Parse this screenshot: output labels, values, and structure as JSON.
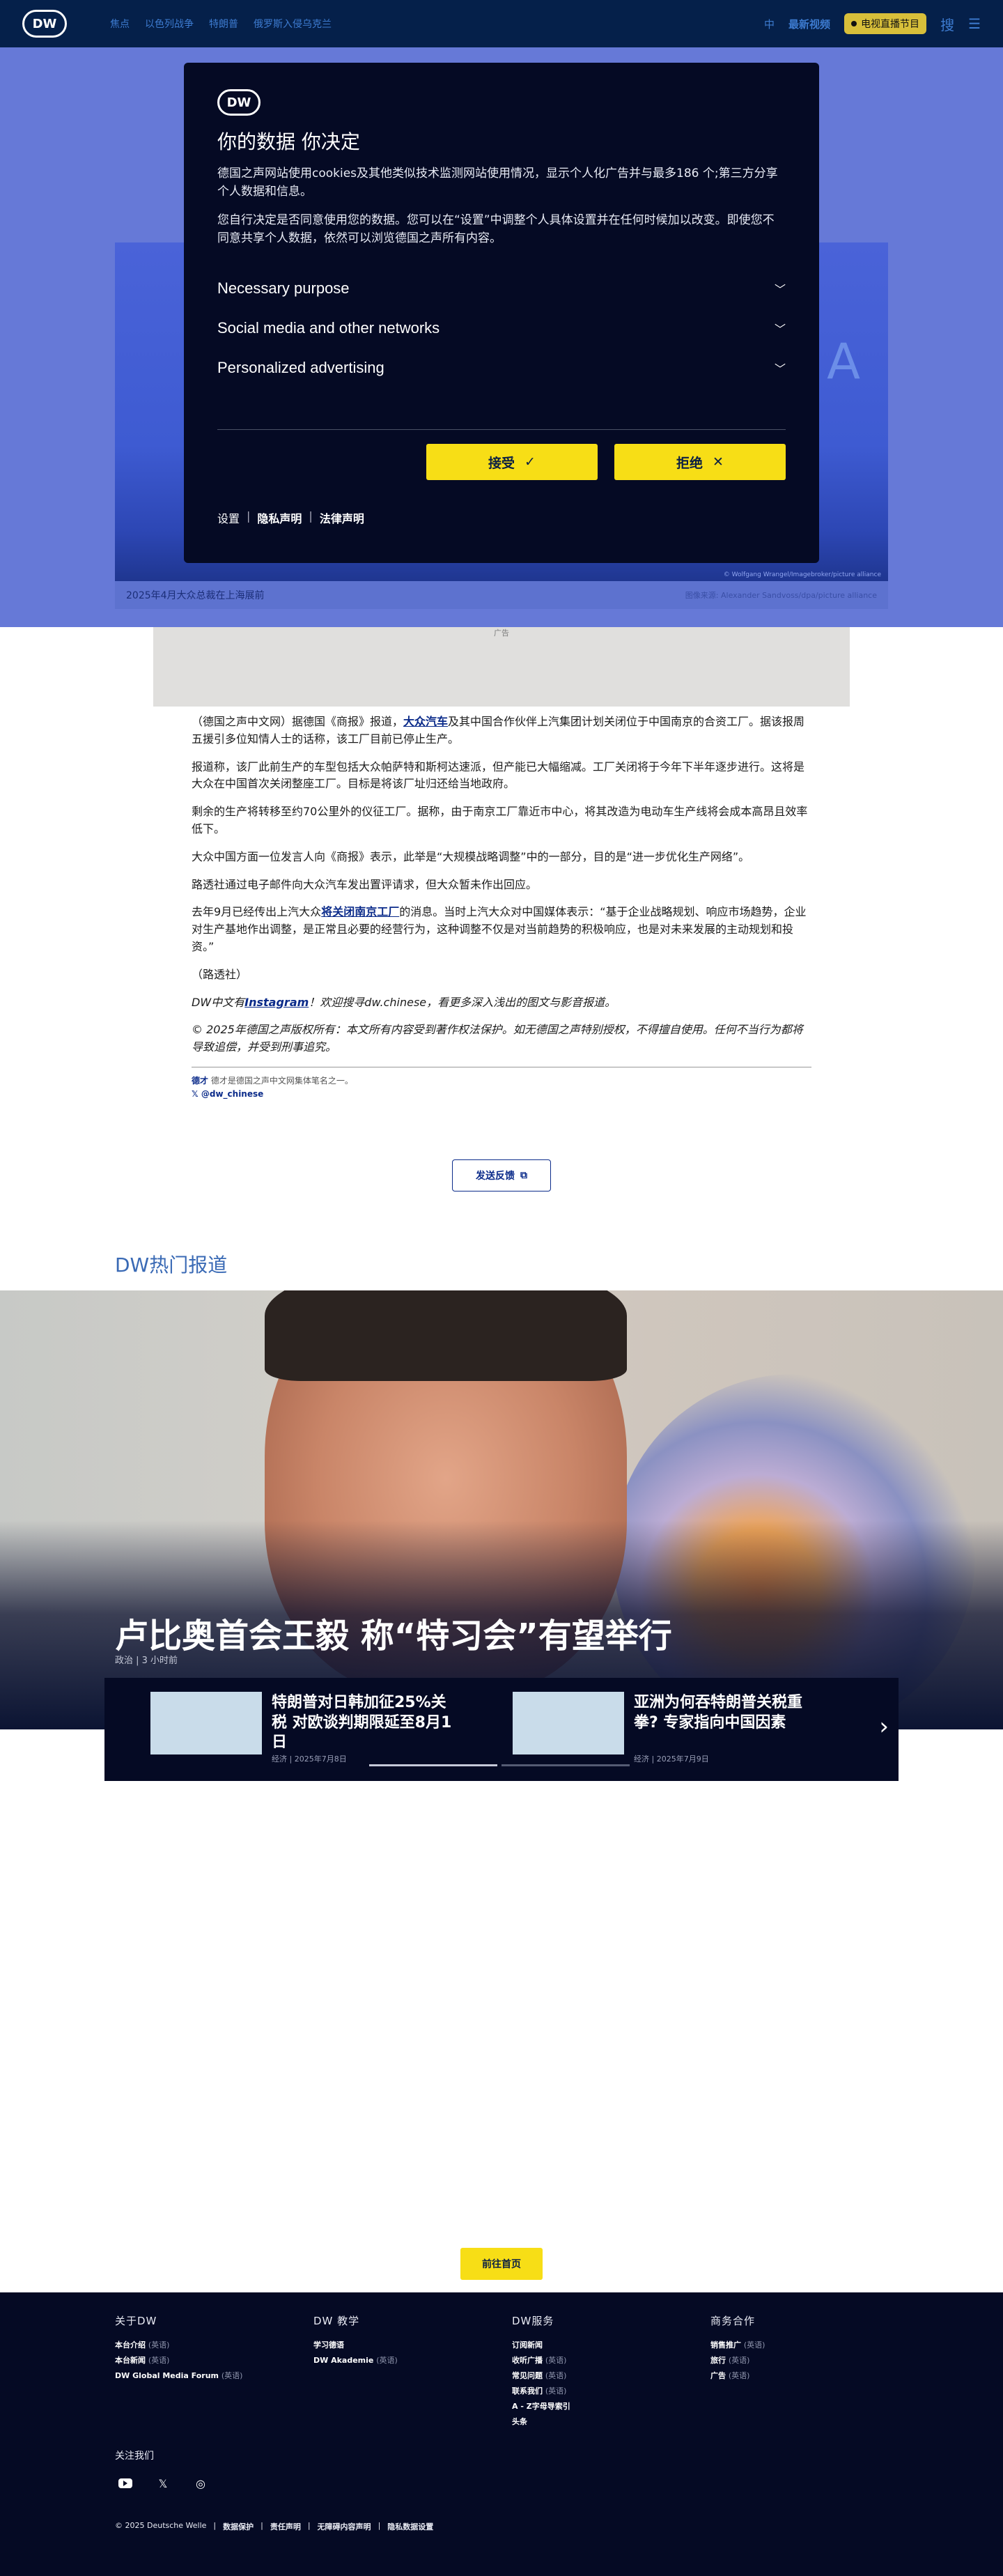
{
  "header": {
    "logo": "DW",
    "nav": [
      "焦点",
      "以色列战争",
      "特朗普",
      "俄罗斯入侵乌克兰"
    ],
    "lang_label": "中",
    "latest": "最新视频",
    "live": "电视直播节目",
    "search": "搜"
  },
  "hero": {
    "ghost_text": "A",
    "credit": "© Wolfgang Wrangel/Imagebroker/picture alliance",
    "caption": "2025年4月大众总裁在上海展前",
    "caption_credit": "图像来源: Alexander Sandvoss/dpa/picture alliance"
  },
  "consent": {
    "logo": "DW",
    "title": "你的数据 你决定",
    "p1": "德国之声网站使用cookies及其他类似技术监测网站使用情况，显示个人化广告并与最多186 个;第三方分享个人数据和信息。",
    "p2": "您自行决定是否同意使用您的数据。您可以在“设置”中调整个人具体设置并在任何时候加以改变。即使您不同意共享个人数据，依然可以浏览德国之声所有内容。",
    "sections": [
      "Necessary purpose",
      "Social media and other networks",
      "Personalized advertising"
    ],
    "accept": "接受",
    "reject": "拒绝",
    "links": [
      "设置",
      "隐私声明",
      "法律声明"
    ]
  },
  "gray_caption": "广告",
  "article": {
    "p1_a": "（德国之声中文网）据德国《商报》报道，",
    "p1_link": "大众汽车",
    "p1_b": "及其中国合作伙伴上汽集团计划关闭位于中国南京的合资工厂。据该报周五援引多位知情人士的话称，该工厂目前已停止生产。",
    "p2": "报道称，该厂此前生产的车型包括大众帕萨特和斯柯达速派，但产能已大幅缩减。工厂关闭将于今年下半年逐步进行。这将是大众在中国首次关闭整座工厂。目标是将该厂址归还给当地政府。",
    "p3": "剩余的生产将转移至约70公里外的仪征工厂。据称，由于南京工厂靠近市中心，将其改造为电动车生产线将会成本高昂且效率低下。",
    "p4": "大众中国方面一位发言人向《商报》表示，此举是“大规模战略调整”中的一部分，目的是“进一步优化生产网络”。",
    "p5": "路透社通过电子邮件向大众汽车发出置评请求，但大众暂未作出回应。",
    "p6_a": "去年9月已经传出上汽大众",
    "p6_link": "将关闭南京工厂",
    "p6_b": "的消息。当时上汽大众对中国媒体表示：“基于企业战略规划、响应市场趋势，企业对生产基地作出调整，是正常且必要的经营行为，这种调整不仅是对当前趋势的积极响应，也是对未来发展的主动规划和投资。”",
    "p7": "（路透社）",
    "p8_a": "DW中文有",
    "p8_link": "Instagram",
    "p8_b": "！欢迎搜寻dw.chinese，看更多深入浅出的图文与影音报道。",
    "p9": "© 2025年德国之声版权所有：本文所有内容受到著作权法保护。如无德国之声特别授权，不得擅自使用。任何不当行为都将导致追偿，并受到刑事追究。",
    "author_label": "德才",
    "author_desc": "德才是德国之声中文网集体笔名之一。",
    "x_handle": "@dw_chinese"
  },
  "feedback": "发送反馈",
  "section_title": "DW热门报道",
  "top_story": {
    "title": "卢比奥首会王毅 称“特习会”有望举行",
    "meta": "政治 | 3 小时前"
  },
  "carousel": [
    {
      "title": "特朗普对日韩加征25%关税 对欧谈判期限延至8月1日",
      "meta": "经济 | 2025年7月8日"
    },
    {
      "title": "亚洲为何吞特朗普关税重拳? 专家指向中国因素",
      "meta": "经济 | 2025年7月9日"
    }
  ],
  "home_button": "前往首页",
  "footer": {
    "cols": [
      {
        "title": "关于DW",
        "items": [
          {
            "t": "本台介绍",
            "s": "(英语)"
          },
          {
            "t": "本台新闻",
            "s": "(英语)"
          },
          {
            "t": "DW Global Media Forum",
            "s": "(英语)"
          }
        ]
      },
      {
        "title": "DW 教学",
        "items": [
          {
            "t": "学习德语",
            "s": ""
          },
          {
            "t": "DW Akademie",
            "s": "(英语)"
          }
        ]
      },
      {
        "title": "DW服务",
        "items": [
          {
            "t": "订阅新闻",
            "s": ""
          },
          {
            "t": "收听广播",
            "s": "(英语)"
          },
          {
            "t": "常见问题",
            "s": "(英语)"
          },
          {
            "t": "联系我们",
            "s": "(英语)"
          },
          {
            "t": "A - Z字母导索引",
            "s": ""
          },
          {
            "t": "头条",
            "s": ""
          }
        ]
      },
      {
        "title": "商务合作",
        "items": [
          {
            "t": "销售推广",
            "s": "(英语)"
          },
          {
            "t": "旅行",
            "s": "(英语)"
          },
          {
            "t": "广告",
            "s": "(英语)"
          }
        ]
      }
    ],
    "follow": "关注我们",
    "copyright": "© 2025 Deutsche Welle",
    "legal": [
      "数据保护",
      "责任声明",
      "无障碍内容声明",
      "隐私数据设置"
    ]
  }
}
